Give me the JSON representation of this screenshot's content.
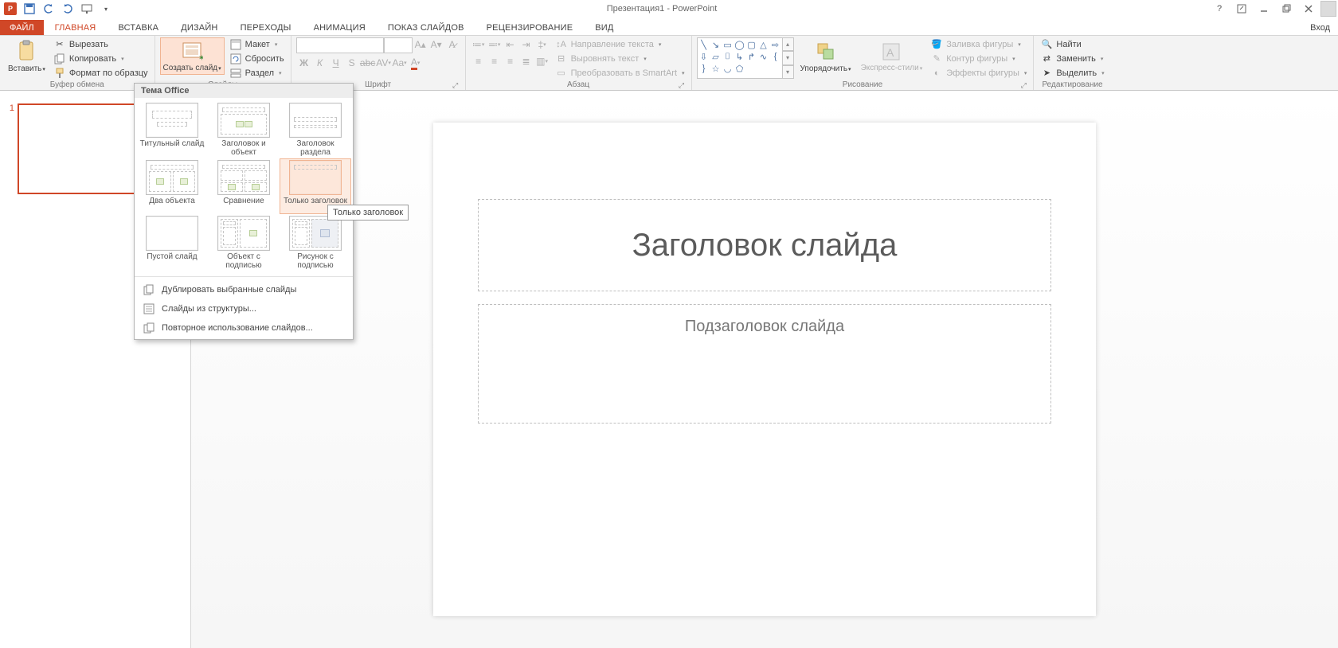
{
  "app": {
    "title": "Презентация1 - PowerPoint",
    "login": "Вход"
  },
  "qat": {
    "save": "save",
    "undo": "undo",
    "redo": "redo",
    "start": "start"
  },
  "tabs": {
    "file": "ФАЙЛ",
    "items": [
      "ГЛАВНАЯ",
      "ВСТАВКА",
      "ДИЗАЙН",
      "ПЕРЕХОДЫ",
      "АНИМАЦИЯ",
      "ПОКАЗ СЛАЙДОВ",
      "РЕЦЕНЗИРОВАНИЕ",
      "ВИД"
    ],
    "active": 0
  },
  "ribbon": {
    "clipboard": {
      "label": "Буфер обмена",
      "paste": "Вставить",
      "cut": "Вырезать",
      "copy": "Копировать",
      "format_painter": "Формат по образцу"
    },
    "slides": {
      "label": "Слайды",
      "new_slide": "Создать слайд",
      "layout": "Макет",
      "reset": "Сбросить",
      "section": "Раздел"
    },
    "font": {
      "label": "Шрифт"
    },
    "paragraph": {
      "label": "Абзац",
      "text_direction": "Направление текста",
      "align_text": "Выровнять текст",
      "smartart": "Преобразовать в SmartArt"
    },
    "drawing": {
      "label": "Рисование",
      "arrange": "Упорядочить",
      "quick_styles": "Экспресс-стили",
      "shape_fill": "Заливка фигуры",
      "shape_outline": "Контур фигуры",
      "shape_effects": "Эффекты фигуры"
    },
    "editing": {
      "label": "Редактирование",
      "find": "Найти",
      "replace": "Заменить",
      "select": "Выделить"
    }
  },
  "dropdown": {
    "header": "Тема Office",
    "layouts": [
      "Титульный слайд",
      "Заголовок и объект",
      "Заголовок раздела",
      "Два объекта",
      "Сравнение",
      "Только заголовок",
      "Пустой слайд",
      "Объект с подписью",
      "Рисунок с подписью"
    ],
    "hover_index": 5,
    "tooltip": "Только заголовок",
    "menu": {
      "duplicate": "Дублировать выбранные слайды",
      "from_outline": "Слайды из структуры...",
      "reuse": "Повторное использование слайдов..."
    }
  },
  "slide": {
    "number": "1",
    "title_placeholder": "Заголовок слайда",
    "subtitle_placeholder": "Подзаголовок слайда"
  },
  "colors": {
    "accent": "#d04727"
  }
}
